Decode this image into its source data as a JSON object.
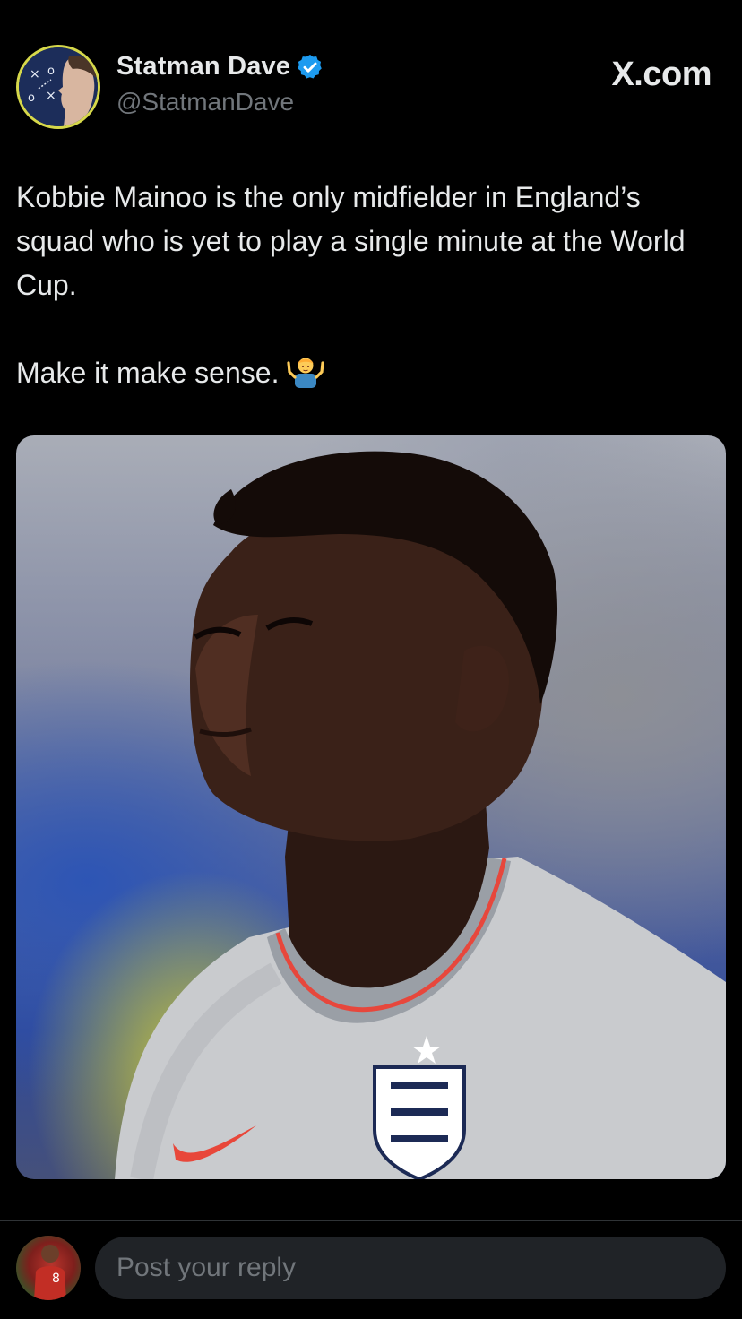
{
  "brand": {
    "site_label": "X.com"
  },
  "author": {
    "display_name": "Statman Dave",
    "handle": "@StatmanDave",
    "verified_color": "#1d9bf0",
    "avatar_icon": "tactics-board-avatar"
  },
  "tweet": {
    "paragraph_1": "Kobbie Mainoo is the only midfielder in England’s squad who is yet to play a single minute at the World Cup.",
    "paragraph_2": "Make it make sense.",
    "emoji": "person-shrugging-emoji"
  },
  "media": {
    "icon": "england-crest",
    "accent_colors": {
      "shirt": "#c9cbce",
      "collar_trim": "#e7473c",
      "logo": "#e8473a"
    }
  },
  "reply": {
    "placeholder": "Post your reply"
  }
}
